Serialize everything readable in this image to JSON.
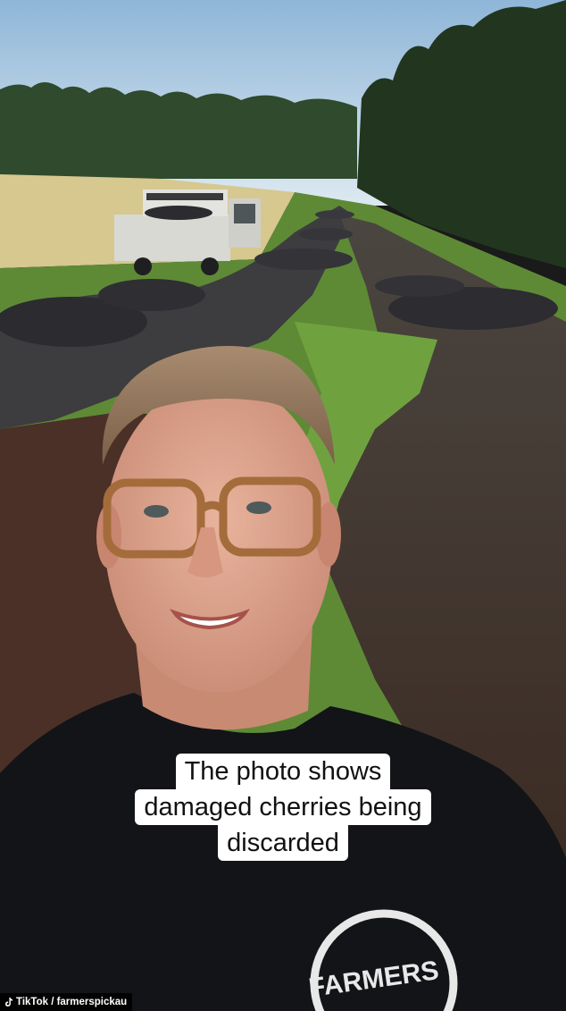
{
  "caption": {
    "line1": "The photo shows",
    "line2": "damaged cherries being",
    "line3": "discarded"
  },
  "credit": {
    "text": "TikTok / farmerspickau",
    "icon": "tiktok-icon"
  },
  "shirt_logo": {
    "text": "FARMERS PICK"
  },
  "colors": {
    "sky": "#b9d4e8",
    "grass": "#6f9b3a",
    "cherries": "#2a2a30",
    "shirt": "#101216",
    "caption_bg": "#ffffff",
    "credit_bg": "#000000"
  }
}
